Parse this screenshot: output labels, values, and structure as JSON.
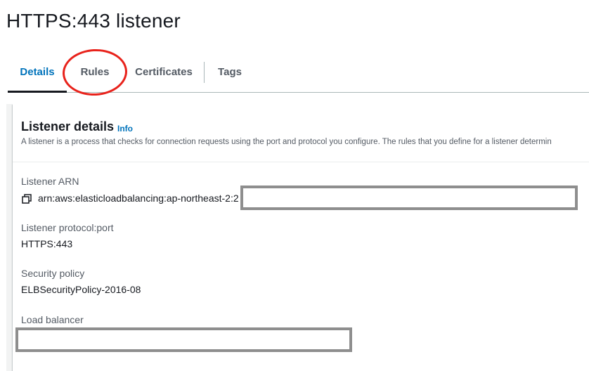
{
  "page": {
    "title": "HTTPS:443 listener"
  },
  "tabs": [
    {
      "label": "Details",
      "active": true
    },
    {
      "label": "Rules",
      "active": false
    },
    {
      "label": "Certificates",
      "active": false
    },
    {
      "label": "Tags",
      "active": false
    }
  ],
  "listener_details": {
    "title": "Listener details",
    "info_label": "Info",
    "description": "A listener is a process that checks for connection requests using the port and protocol you configure. The rules that you define for a listener determin",
    "fields": {
      "arn": {
        "label": "Listener ARN",
        "value": "arn:aws:elasticloadbalancing:ap-northeast-2:2"
      },
      "protocol_port": {
        "label": "Listener protocol:port",
        "value": "HTTPS:443"
      },
      "security_policy": {
        "label": "Security policy",
        "value": "ELBSecurityPolicy-2016-08"
      },
      "load_balancer": {
        "label": "Load balancer",
        "value": ""
      }
    }
  },
  "icons": {
    "copy": "copy-icon"
  },
  "colors": {
    "accent_link": "#0073bb",
    "annotation_red": "#e8221b",
    "redaction_border": "#8e8e8e"
  }
}
